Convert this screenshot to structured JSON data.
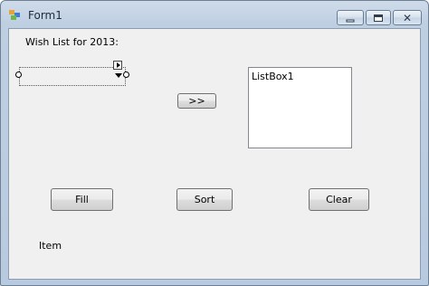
{
  "window": {
    "title": "Form1",
    "icon": "winform-app-icon",
    "caption_buttons": [
      "minimize-icon",
      "maximize-icon",
      "close-icon"
    ],
    "close_glyph": "✕"
  },
  "form": {
    "heading": "Wish List for 2013:",
    "add_button": ">>",
    "listbox": {
      "items": [
        "ListBox1"
      ]
    },
    "buttons": {
      "fill": "Fill",
      "sort": "Sort",
      "clear": "Clear"
    },
    "item_label": "Item"
  },
  "colors": {
    "client_background": "#f0f0f0",
    "title_bar": "#bfcfe2"
  }
}
